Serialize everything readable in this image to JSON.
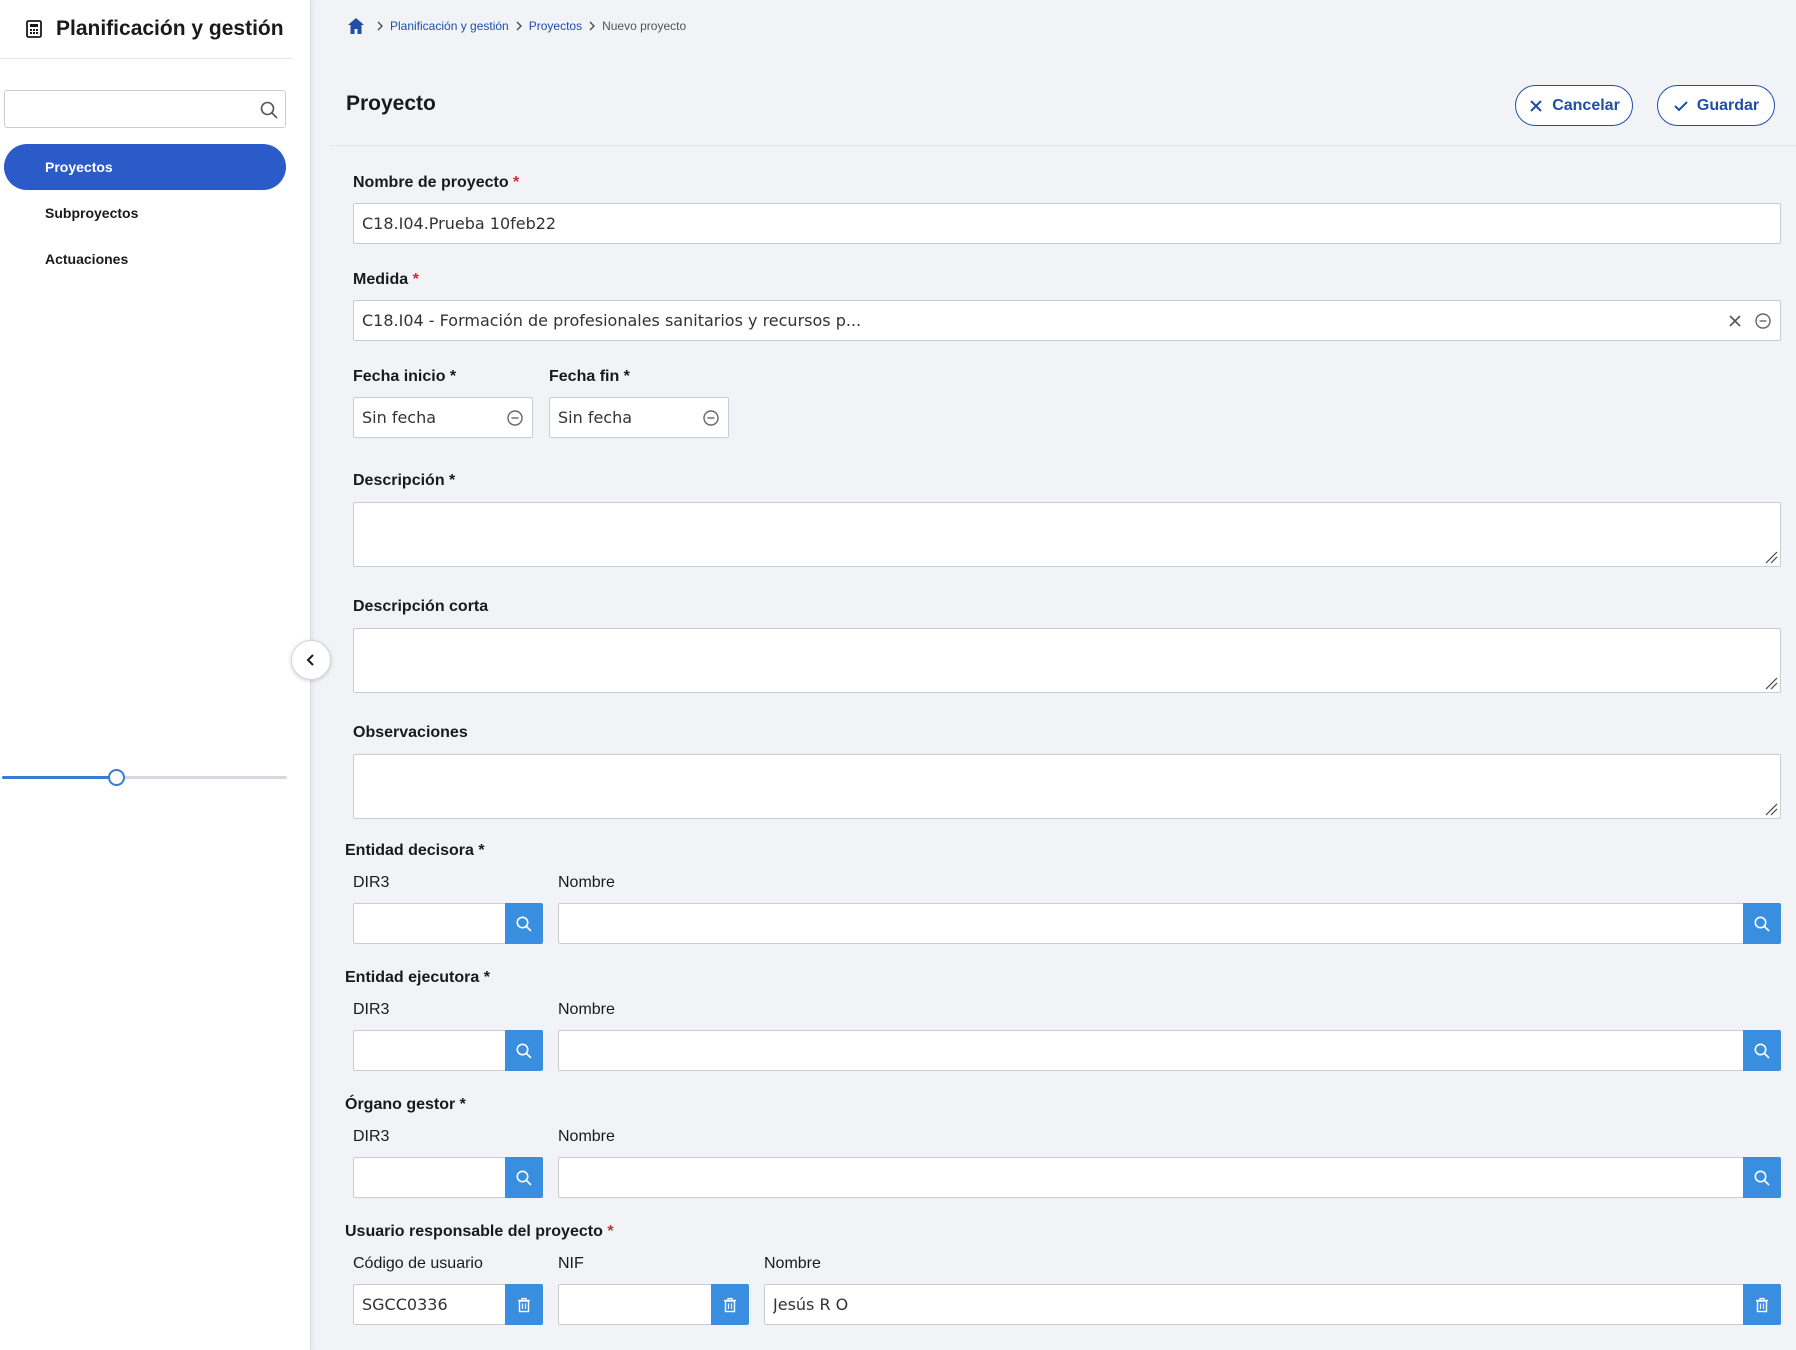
{
  "app": {
    "title": "Planificación y gestión",
    "icon": "calculator-icon"
  },
  "sidebar": {
    "search_placeholder": "",
    "items": [
      {
        "label": "Proyectos",
        "active": true
      },
      {
        "label": "Subproyectos",
        "active": false
      },
      {
        "label": "Actuaciones",
        "active": false
      }
    ],
    "zoom_slider_fraction": 0.4
  },
  "breadcrumb": {
    "items": [
      "Planificación y gestión",
      "Proyectos"
    ],
    "current": "Nuevo proyecto"
  },
  "header": {
    "title": "Proyecto",
    "cancel_label": "Cancelar",
    "save_label": "Guardar"
  },
  "form": {
    "nombre": {
      "label": "Nombre de proyecto",
      "value": "C18.I04.Prueba 10feb22"
    },
    "medida": {
      "label": "Medida",
      "value": "C18.I04 - Formación de profesionales sanitarios y recursos p..."
    },
    "fecha_inicio": {
      "label": "Fecha inicio *",
      "value": "Sin fecha"
    },
    "fecha_fin": {
      "label": "Fecha fin *",
      "value": "Sin fecha"
    },
    "descripcion": {
      "label": "Descripción *",
      "value": ""
    },
    "descripcion_corta": {
      "label": "Descripción corta",
      "value": ""
    },
    "observaciones": {
      "label": "Observaciones",
      "value": ""
    },
    "entidad_decisora": {
      "label": "Entidad decisora *",
      "dir3_label": "DIR3",
      "nombre_label": "Nombre",
      "dir3": "",
      "nombre": ""
    },
    "entidad_ejecutora": {
      "label": "Entidad ejecutora *",
      "dir3_label": "DIR3",
      "nombre_label": "Nombre",
      "dir3": "",
      "nombre": ""
    },
    "organo_gestor": {
      "label": "Órgano gestor *",
      "dir3_label": "DIR3",
      "nombre_label": "Nombre",
      "dir3": "",
      "nombre": ""
    },
    "usuario": {
      "label": "Usuario responsable del proyecto",
      "codigo_label": "Código de usuario",
      "nif_label": "NIF",
      "nombre_label": "Nombre",
      "codigo": "SGCC0336",
      "nif": "",
      "nombre": "Jesús R O"
    }
  },
  "colors": {
    "primary": "#2a5bc9",
    "link": "#1f4fa8",
    "action": "#3a8ee0",
    "required": "#d03030"
  }
}
